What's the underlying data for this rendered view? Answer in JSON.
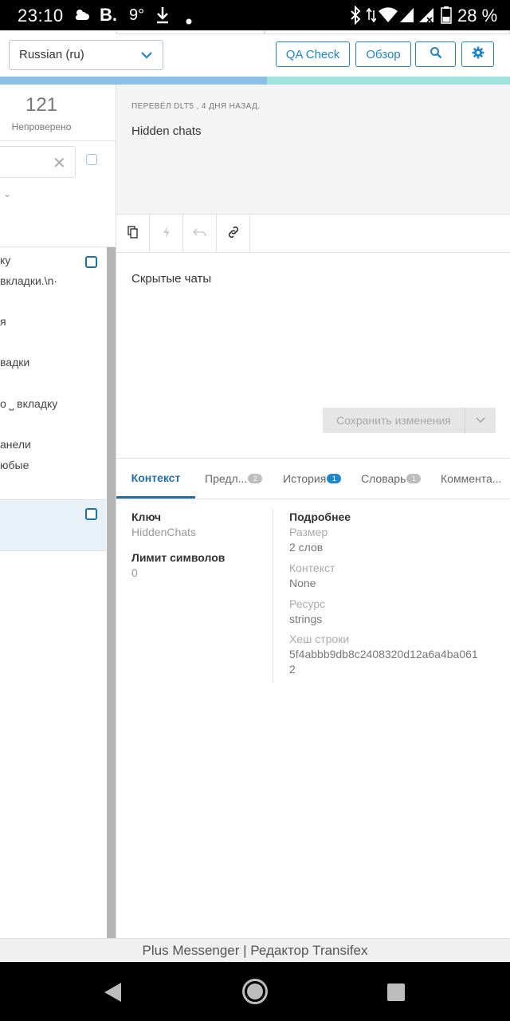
{
  "status_bar": {
    "time": "23:10",
    "temperature": "9°",
    "battery": "28 %",
    "icons": [
      "weather-icon",
      "vk-icon",
      "download-icon",
      "dot-icon",
      "bluetooth-icon",
      "data-icon",
      "wifi-icon",
      "signal-icon",
      "signal-x-icon",
      "battery-icon"
    ]
  },
  "header": {
    "language_value": "Russian (ru)",
    "qa_check_label": "QA Check",
    "review_label": "Обзор",
    "search_icon": "search-icon",
    "settings_icon": "gear-icon"
  },
  "progress": {
    "translated_fraction": 0.523
  },
  "left_panel": {
    "count": "121",
    "count_label": "Непроверено",
    "list_fragments": [
      "ку",
      "вкладки.\\n·",
      "я",
      "вадки",
      "о ⎵ вкладку",
      "анели",
      "юбые"
    ]
  },
  "source": {
    "meta": "ПЕРЕВЁЛ DLT5 , 4 ДНЯ НАЗАД.",
    "text": "Hidden chats"
  },
  "editor": {
    "tools": [
      "copy-icon",
      "lightning-icon",
      "undo-icon",
      "link-icon"
    ],
    "translation": "Скрытые чаты",
    "save_label": "Сохранить изменения"
  },
  "tabs": [
    {
      "label": "Контекст",
      "badge": ""
    },
    {
      "label": "Предл...",
      "badge": "2"
    },
    {
      "label": "История",
      "badge": "1"
    },
    {
      "label": "Словарь",
      "badge": "1"
    },
    {
      "label": "Коммента...",
      "badge": ""
    }
  ],
  "context": {
    "key_label": "Ключ",
    "key_value": "HiddenChats",
    "limit_label": "Лимит символов",
    "limit_value": "0",
    "details_label": "Подробнее",
    "size_label": "Размер",
    "size_value": "2 слов",
    "context_label": "Контекст",
    "context_value": "None",
    "resource_label": "Ресурс",
    "resource_value": "strings",
    "hash_label": "Хеш строки",
    "hash_value_line1": "5f4abbb9db8c2408320d12a6a4ba061",
    "hash_value_line2": "2"
  },
  "footer": {
    "title": "Plus Messenger | Редактор Transifex"
  },
  "nav": {
    "icons": [
      "back-icon",
      "home-icon",
      "recents-icon"
    ]
  }
}
